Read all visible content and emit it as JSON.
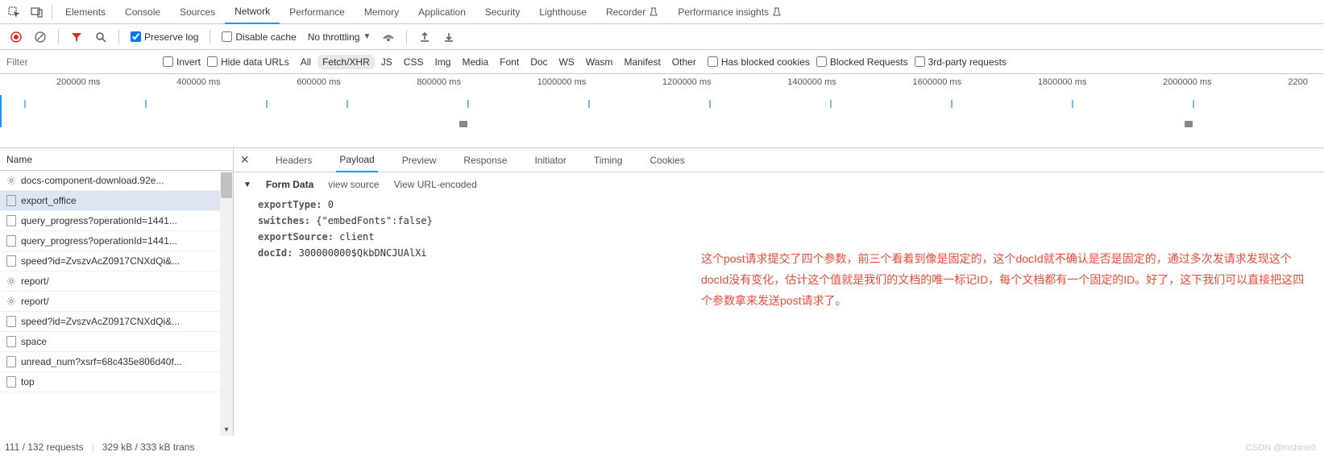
{
  "tabs": [
    "Elements",
    "Console",
    "Sources",
    "Network",
    "Performance",
    "Memory",
    "Application",
    "Security",
    "Lighthouse",
    "Recorder",
    "Performance insights"
  ],
  "tabs_active": "Network",
  "tabs_with_flask": [
    "Recorder",
    "Performance insights"
  ],
  "toolbar": {
    "preserve_log": "Preserve log",
    "preserve_log_checked": true,
    "disable_cache": "Disable cache",
    "disable_cache_checked": false,
    "throttling": "No throttling"
  },
  "filter_row": {
    "placeholder": "Filter",
    "invert": "Invert",
    "hide_data_urls": "Hide data URLs",
    "types": [
      "All",
      "Fetch/XHR",
      "JS",
      "CSS",
      "Img",
      "Media",
      "Font",
      "Doc",
      "WS",
      "Wasm",
      "Manifest",
      "Other"
    ],
    "types_active": "Fetch/XHR",
    "has_blocked_cookies": "Has blocked cookies",
    "blocked_requests": "Blocked Requests",
    "third_party": "3rd-party requests"
  },
  "timeline_ticks": [
    "200000 ms",
    "400000 ms",
    "600000 ms",
    "800000 ms",
    "1000000 ms",
    "1200000 ms",
    "1400000 ms",
    "1600000 ms",
    "1800000 ms",
    "2000000 ms",
    "2200"
  ],
  "name_header": "Name",
  "requests": [
    {
      "label": "docs-component-download.92e...",
      "icon": "gear"
    },
    {
      "label": "export_office",
      "icon": "file",
      "selected": true
    },
    {
      "label": "query_progress?operationId=1441...",
      "icon": "file"
    },
    {
      "label": "query_progress?operationId=1441...",
      "icon": "file"
    },
    {
      "label": "speed?id=ZvszvAcZ0917CNXdQi&...",
      "icon": "file"
    },
    {
      "label": "report/",
      "icon": "gear"
    },
    {
      "label": "report/",
      "icon": "gear"
    },
    {
      "label": "speed?id=ZvszvAcZ0917CNXdQi&...",
      "icon": "file"
    },
    {
      "label": "space",
      "icon": "file"
    },
    {
      "label": "unread_num?xsrf=68c435e806d40f...",
      "icon": "file"
    },
    {
      "label": "top",
      "icon": "file"
    }
  ],
  "detail_tabs": [
    "Headers",
    "Payload",
    "Preview",
    "Response",
    "Initiator",
    "Timing",
    "Cookies"
  ],
  "detail_tab_active": "Payload",
  "form_data": {
    "section_title": "Form Data",
    "view_source": "view source",
    "view_url_encoded": "View URL-encoded",
    "items": [
      {
        "k": "exportType:",
        "v": "0"
      },
      {
        "k": "switches:",
        "v": "{\"embedFonts\":false}"
      },
      {
        "k": "exportSource:",
        "v": "client"
      },
      {
        "k": "docId:",
        "v": "300000000$QkbDNCJUAlXi"
      }
    ]
  },
  "annotation": "这个post请求提交了四个参数，前三个看着到像是固定的，这个docId就不确认是否是固定的，通过多次发请求发现这个docId没有变化，估计这个值就是我们的文档的唯一标记ID，每个文档都有一个固定的ID。好了，这下我们可以直接把这四个参数拿来发送post请求了。",
  "status": {
    "requests": "111 / 132 requests",
    "transfer": "329 kB / 333 kB trans"
  },
  "watermark": "CSDN @mshine0"
}
